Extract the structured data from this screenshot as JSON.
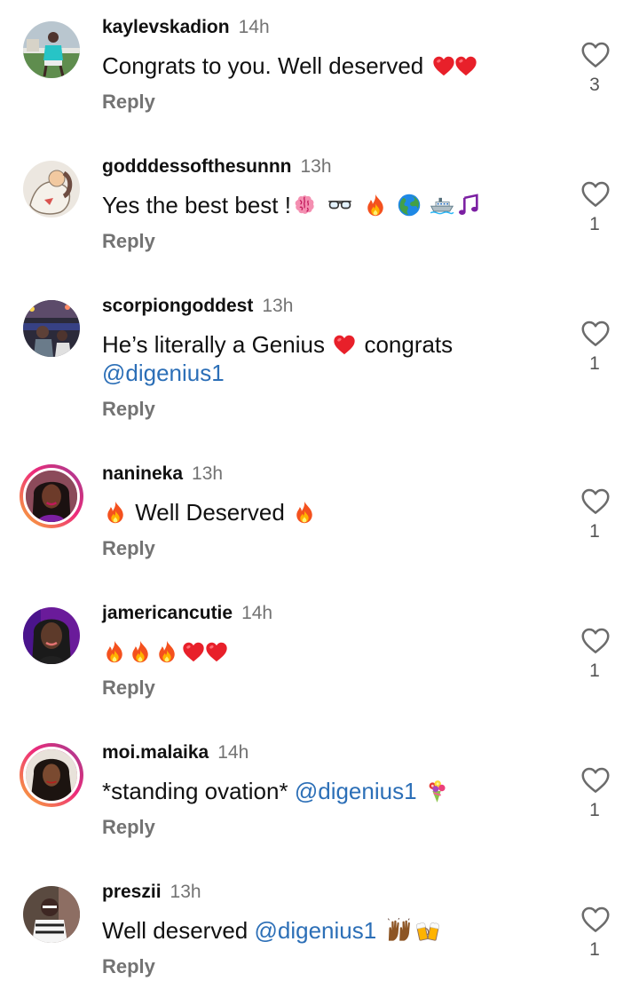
{
  "reply_label": "Reply",
  "colors": {
    "username": "#111111",
    "meta": "#737373",
    "mention": "#2c6fb7",
    "story_ring": [
      "#f9b233",
      "#ee2a7b",
      "#a13bb5"
    ]
  },
  "comments": [
    {
      "username": "kaylevskadion",
      "time": "14h",
      "text": "Congrats to you. Well deserved",
      "emojis": [
        "red-heart",
        "red-heart"
      ],
      "likes": "3",
      "story_ring": false
    },
    {
      "username": "godddessofthesunnn",
      "time": "13h",
      "text": "Yes the best best !",
      "emojis": [
        "brain",
        "glasses",
        "fire",
        "globe",
        "ship",
        "music-notes"
      ],
      "likes": "1",
      "story_ring": false
    },
    {
      "username": "scorpiongoddest",
      "time": "13h",
      "text_before": "He’s literally a Genius",
      "text_after": "congrats",
      "mention": "@digenius1",
      "emojis": [
        "red-heart"
      ],
      "likes": "1",
      "story_ring": false
    },
    {
      "username": "nanineka",
      "time": "13h",
      "text": "Well Deserved",
      "emojis": [
        "fire",
        "fire"
      ],
      "likes": "1",
      "story_ring": true
    },
    {
      "username": "jamericancutie",
      "time": "14h",
      "emojis": [
        "fire",
        "fire",
        "fire",
        "red-heart",
        "red-heart"
      ],
      "likes": "1",
      "story_ring": false
    },
    {
      "username": "moi.malaika",
      "time": "14h",
      "text": "*standing ovation*",
      "mention": "@digenius1",
      "emojis": [
        "bouquet"
      ],
      "likes": "1",
      "story_ring": true
    },
    {
      "username": "preszii",
      "time": "13h",
      "text": "Well deserved",
      "mention": "@digenius1",
      "emojis": [
        "raised-hands",
        "clinking-beers"
      ],
      "likes": "1",
      "story_ring": false
    }
  ]
}
